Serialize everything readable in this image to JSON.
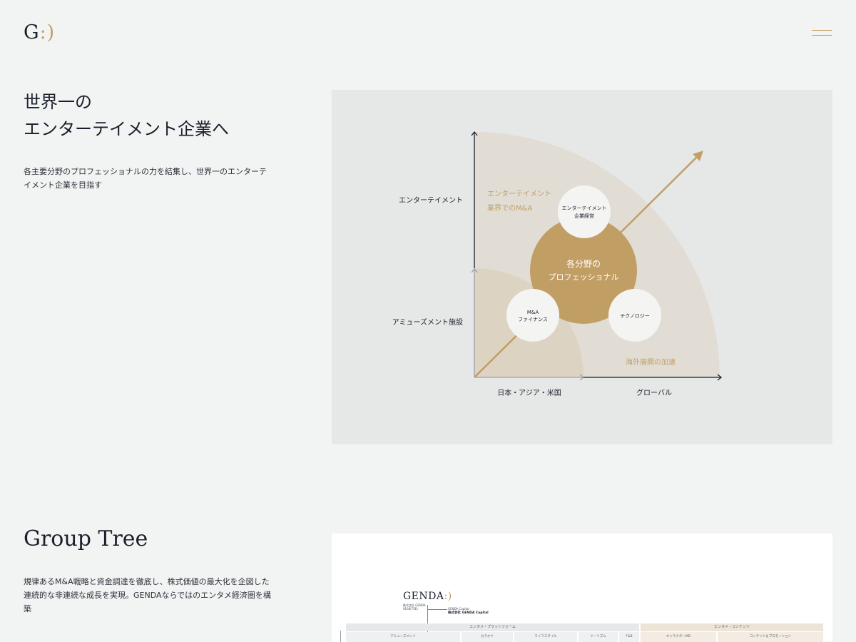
{
  "header": {
    "logo_letter": "G",
    "logo_mark": ":)"
  },
  "vision": {
    "title_line1": "世界一の",
    "title_line2": "エンターテイメント企業へ",
    "description": "各主要分野のプロフェッショナルの力を結集し、世界一のエンターテイメント企業を目指す",
    "diagram": {
      "y_label_top": "エンターテイメント",
      "y_label_bottom": "アミューズメント施設",
      "x_label_left": "日本・アジア・米国",
      "x_label_right": "グローバル",
      "outer_note_line1": "エンターテイメント",
      "outer_note_line2": "業界でのM&A",
      "corner_note": "海外展開の加速",
      "center_line1": "各分野の",
      "center_line2": "プロフェッショナル",
      "top_circle_line1": "エンターテイメント",
      "top_circle_line2": "企業経営",
      "left_circle_line1": "M&A",
      "left_circle_line2": "ファイナンス",
      "right_circle": "テクノロジー"
    }
  },
  "group_tree": {
    "title": "Group Tree",
    "description": "規律あるM&A戦略と資金調達を徹底し、株式価値の最大化を企図した連続的な非連続な成長を実現。GENDAならではのエンタメ経済圏を構築",
    "tree": {
      "logo": "GENDA",
      "logo_mark": ":)",
      "parent_label": "株式会社 GENDA",
      "parent_ticker": "9166(TSE)",
      "capital_title": "GENDA Capital",
      "capital_name": "株式会社 GENDA Capital",
      "platform_label": "エンタメ・プラットフォーム",
      "contents_label": "エンタメ・コンテンツ",
      "platform_cells": [
        "アミューズメント",
        "カラオケ",
        "ライフスタイル",
        "ツーリズム",
        "F&B"
      ],
      "contents_cells": [
        "キャラクターMD",
        "コンテンツ＆プロモーション"
      ]
    }
  },
  "colors": {
    "page_bg": "#f2f4f3",
    "panel_bg": "#e6e8e7",
    "accent_gold": "#c19e64",
    "fan_outer": "#e1ddd5",
    "fan_inner": "#dcd3c2",
    "text_dark": "#1a1f2b"
  }
}
